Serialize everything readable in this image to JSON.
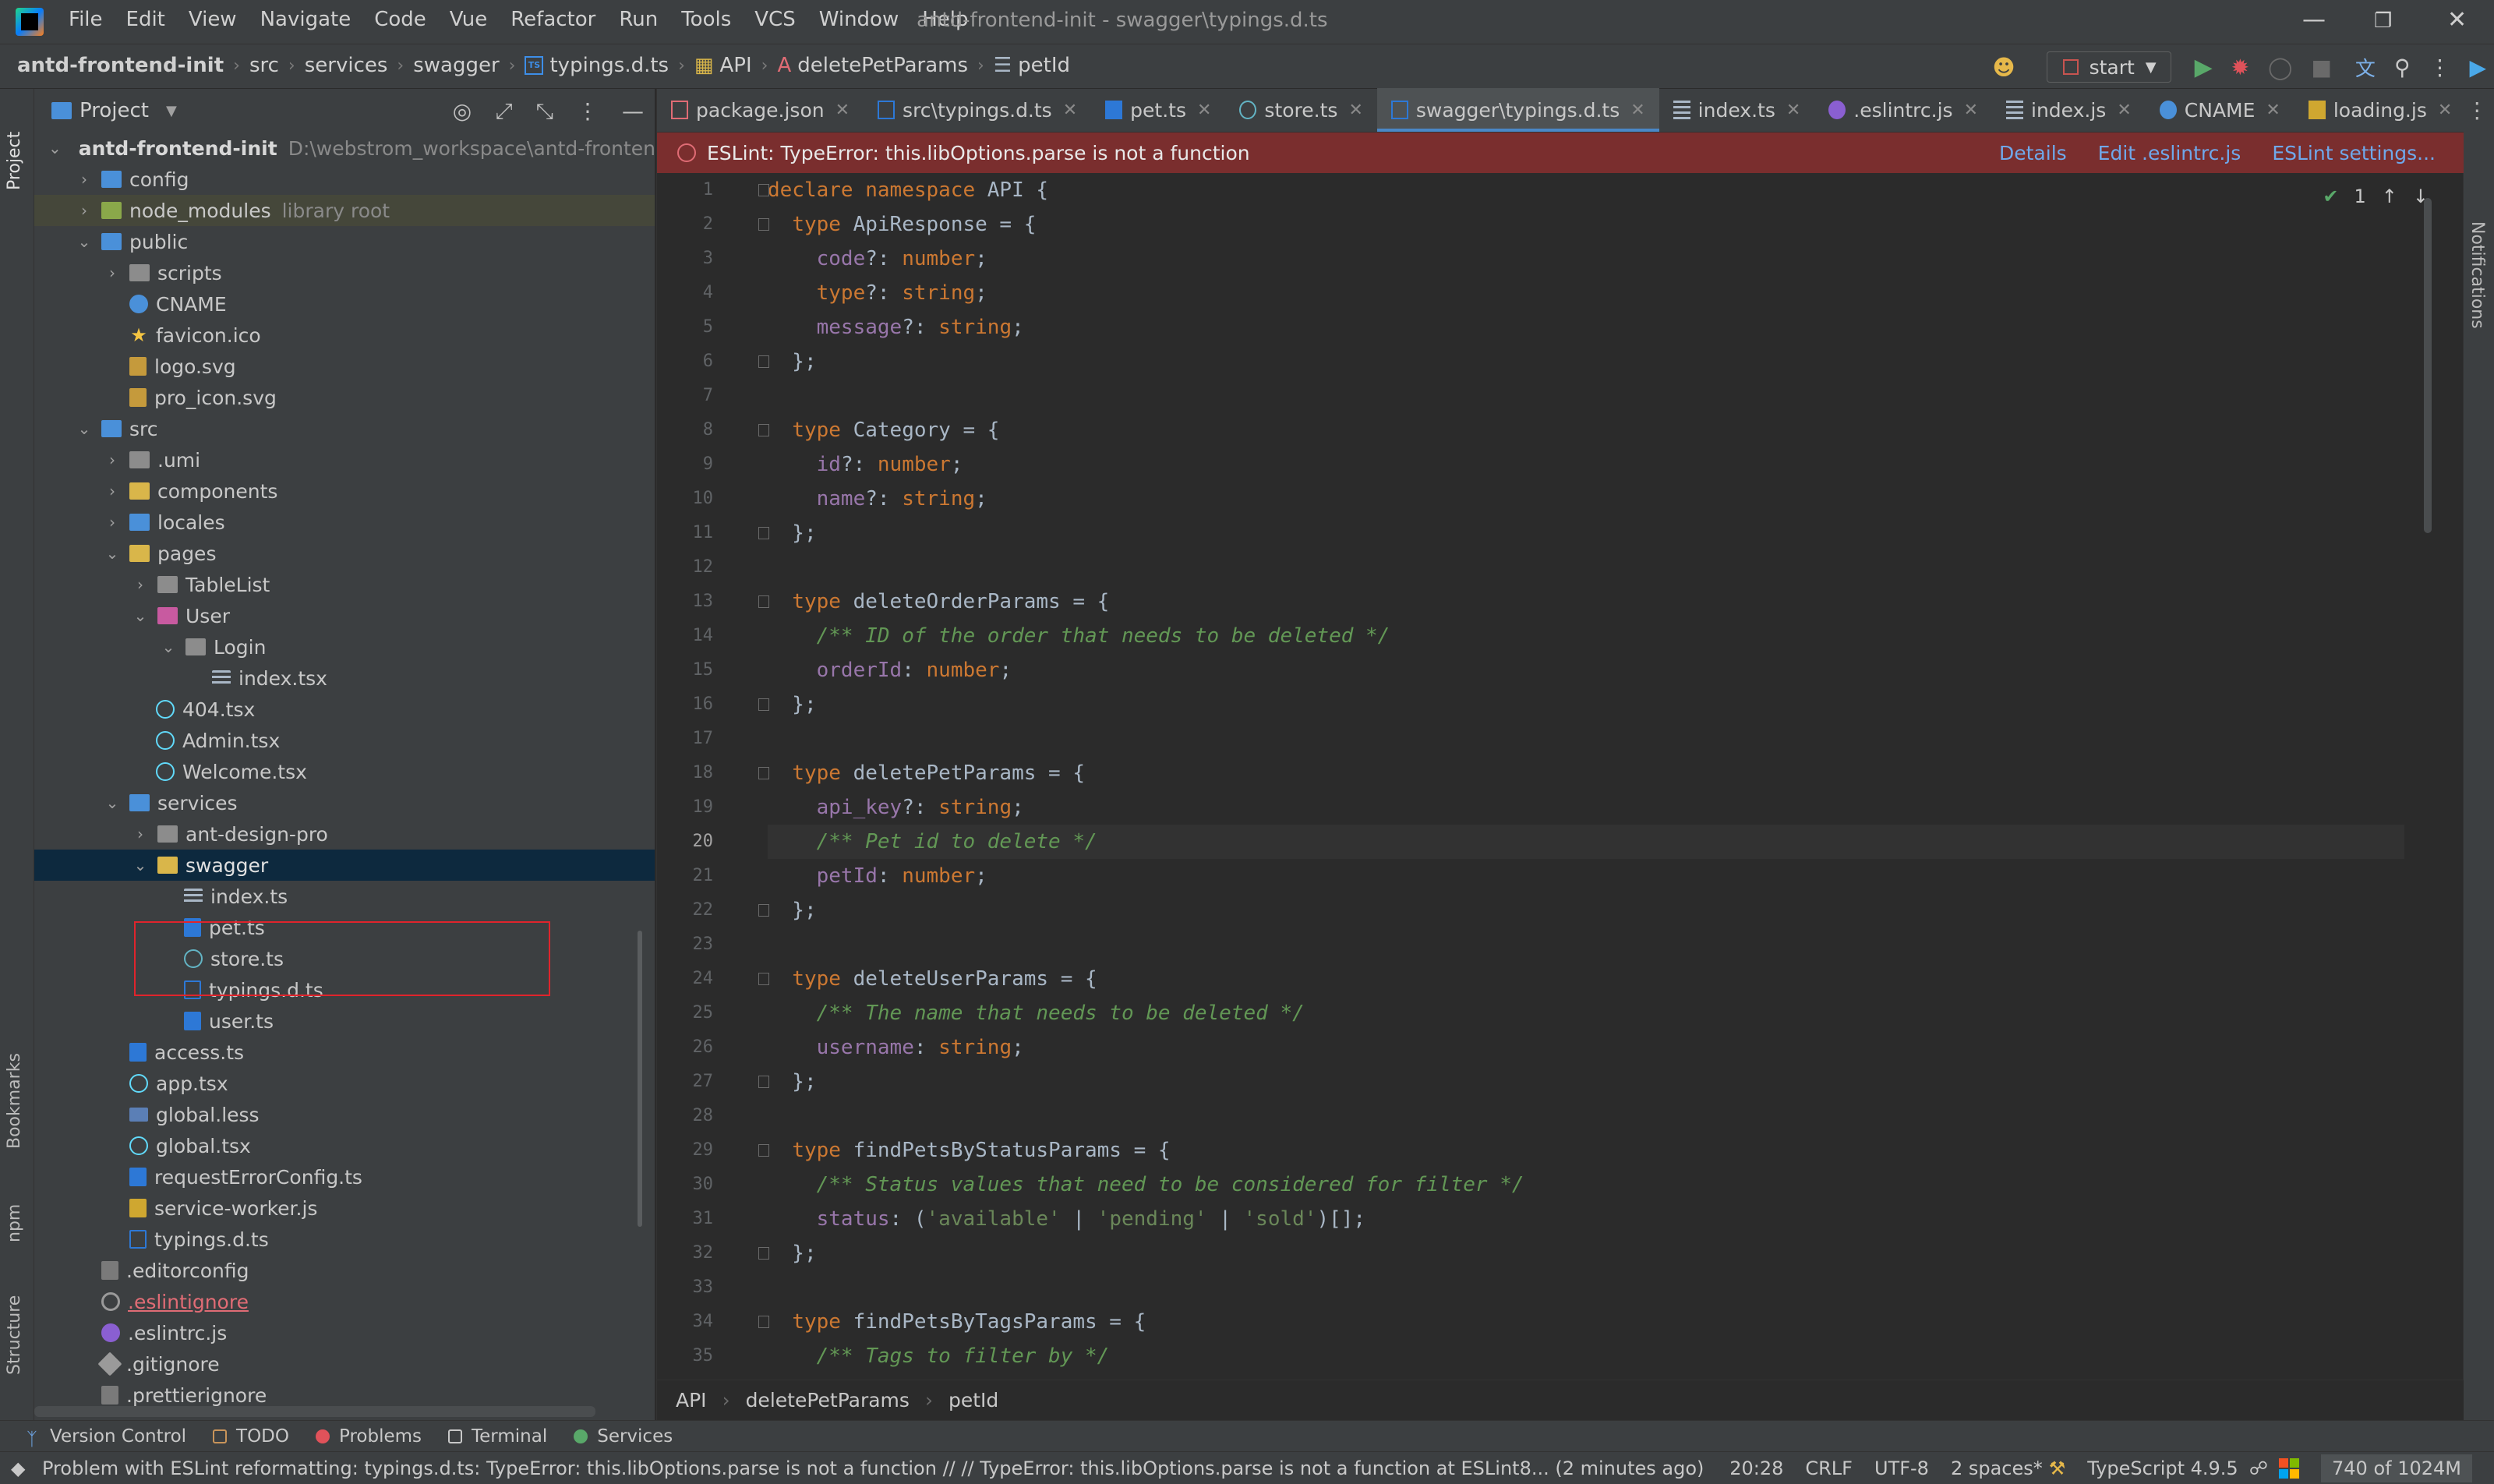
{
  "window": {
    "title": "antd-frontend-init - swagger\\typings.d.ts",
    "menu": [
      "File",
      "Edit",
      "View",
      "Navigate",
      "Code",
      "Vue",
      "Refactor",
      "Run",
      "Tools",
      "VCS",
      "Window",
      "Help"
    ]
  },
  "navbar": {
    "breadcrumbs": [
      "antd-frontend-init",
      "src",
      "services",
      "swagger",
      "typings.d.ts",
      "API",
      "deletePetParams",
      "petId"
    ],
    "run_config": "start"
  },
  "project_panel": {
    "title": "Project",
    "root": {
      "name": "antd-frontend-init",
      "path": "D:\\webstrom_workspace\\antd-frontend-i"
    },
    "items": [
      {
        "label": "config",
        "hint": ""
      },
      {
        "label": "node_modules",
        "hint": "library root"
      },
      {
        "label": "public",
        "hint": ""
      },
      {
        "label": "scripts",
        "hint": ""
      },
      {
        "label": "CNAME",
        "hint": ""
      },
      {
        "label": "favicon.ico",
        "hint": ""
      },
      {
        "label": "logo.svg",
        "hint": ""
      },
      {
        "label": "pro_icon.svg",
        "hint": ""
      },
      {
        "label": "src",
        "hint": ""
      },
      {
        "label": ".umi",
        "hint": ""
      },
      {
        "label": "components",
        "hint": ""
      },
      {
        "label": "locales",
        "hint": ""
      },
      {
        "label": "pages",
        "hint": ""
      },
      {
        "label": "TableList",
        "hint": ""
      },
      {
        "label": "User",
        "hint": ""
      },
      {
        "label": "Login",
        "hint": ""
      },
      {
        "label": "index.tsx",
        "hint": ""
      },
      {
        "label": "404.tsx",
        "hint": ""
      },
      {
        "label": "Admin.tsx",
        "hint": ""
      },
      {
        "label": "Welcome.tsx",
        "hint": ""
      },
      {
        "label": "services",
        "hint": ""
      },
      {
        "label": "ant-design-pro",
        "hint": ""
      },
      {
        "label": "swagger",
        "hint": ""
      },
      {
        "label": "index.ts",
        "hint": ""
      },
      {
        "label": "pet.ts",
        "hint": ""
      },
      {
        "label": "store.ts",
        "hint": ""
      },
      {
        "label": "typings.d.ts",
        "hint": ""
      },
      {
        "label": "user.ts",
        "hint": ""
      },
      {
        "label": "access.ts",
        "hint": ""
      },
      {
        "label": "app.tsx",
        "hint": ""
      },
      {
        "label": "global.less",
        "hint": ""
      },
      {
        "label": "global.tsx",
        "hint": ""
      },
      {
        "label": "requestErrorConfig.ts",
        "hint": ""
      },
      {
        "label": "service-worker.js",
        "hint": ""
      },
      {
        "label": "typings.d.ts",
        "hint": ""
      },
      {
        "label": ".editorconfig",
        "hint": ""
      },
      {
        "label": ".eslintignore",
        "hint": ""
      },
      {
        "label": ".eslintrc.js",
        "hint": ""
      },
      {
        "label": ".gitignore",
        "hint": ""
      },
      {
        "label": ".prettierignore",
        "hint": ""
      }
    ]
  },
  "left_stripe": [
    "Project",
    "Bookmarks",
    "npm",
    "Structure"
  ],
  "right_stripe": [
    "Notifications"
  ],
  "tabs": [
    "package.json",
    "src\\typings.d.ts",
    "pet.ts",
    "store.ts",
    "swagger\\typings.d.ts",
    "index.ts",
    ".eslintrc.js",
    "index.js",
    "CNAME",
    "loading.js"
  ],
  "eslint_banner": {
    "message": "ESLint: TypeError: this.libOptions.parse is not a function",
    "links": [
      "Details",
      "Edit .eslintrc.js",
      "ESLint settings..."
    ]
  },
  "inspection_count": "1",
  "code_lines": [
    "declare namespace API {",
    "  type ApiResponse = {",
    "    code?: number;",
    "    type?: string;",
    "    message?: string;",
    "  };",
    "",
    "  type Category = {",
    "    id?: number;",
    "    name?: string;",
    "  };",
    "",
    "  type deleteOrderParams = {",
    "    /** ID of the order that needs to be deleted */",
    "    orderId: number;",
    "  };",
    "",
    "  type deletePetParams = {",
    "    api_key?: string;",
    "    /** Pet id to delete */",
    "    petId: number;",
    "  };",
    "",
    "  type deleteUserParams = {",
    "    /** The name that needs to be deleted */",
    "    username: string;",
    "  };",
    "",
    "  type findPetsByStatusParams = {",
    "    /** Status values that need to be considered for filter */",
    "    status: ('available' | 'pending' | 'sold')[];",
    "  };",
    "",
    "  type findPetsByTagsParams = {",
    "    /** Tags to filter by */"
  ],
  "current_line": 20,
  "editor_breadcrumbs": [
    "API",
    "deletePetParams",
    "petId"
  ],
  "tool_windows": [
    "Version Control",
    "TODO",
    "Problems",
    "Terminal",
    "Services"
  ],
  "status": {
    "message": "Problem with ESLint reformatting: typings.d.ts: TypeError: this.libOptions.parse is not a function // // TypeError: this.libOptions.parse is not a function    at ESLint8... (2 minutes ago)",
    "position": "20:28",
    "line_sep": "CRLF",
    "encoding": "UTF-8",
    "indent": "2 spaces*",
    "language": "TypeScript 4.9.5",
    "memory": "740 of 1024M"
  }
}
